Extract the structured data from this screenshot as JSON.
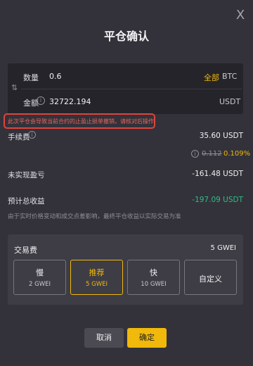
{
  "dialog": {
    "title": "平仓确认",
    "close_glyph": "X"
  },
  "order": {
    "quantity_label": "数量",
    "quantity_value": "0.6",
    "all_label": "全部",
    "quantity_unit": "BTC",
    "amount_label": "金额",
    "amount_value": "32722.194",
    "amount_unit": "USDT",
    "swap_icon": "swap-vertical-icon"
  },
  "warning": {
    "text": "此次平仓会导致当前合约的止盈止损单撤销，请核对后操作",
    "border_color": "#e0433a"
  },
  "fee": {
    "label": "手续费",
    "value": "35.60 USDT",
    "rate_old": "0.112",
    "rate_new": "0.109%"
  },
  "pnl": {
    "label": "未实现盈亏",
    "value": "-161.48 USDT"
  },
  "estimate": {
    "label": "预计总收益",
    "value": "-197.09 USDT",
    "note": "由于实时价格变动和成交点差影响，最终平仓收益以实际交易为准"
  },
  "gas": {
    "label": "交易费",
    "value": "5 GWEI",
    "options": [
      {
        "title": "慢",
        "sub": "2 GWEI"
      },
      {
        "title": "推荐",
        "sub": "5 GWEI"
      },
      {
        "title": "快",
        "sub": "10 GWEI"
      },
      {
        "title": "自定义"
      }
    ]
  },
  "actions": {
    "cancel": "取消",
    "confirm": "确定"
  },
  "colors": {
    "accent": "#f0b90b",
    "positive": "#2ebd85",
    "background": "#33323a"
  }
}
